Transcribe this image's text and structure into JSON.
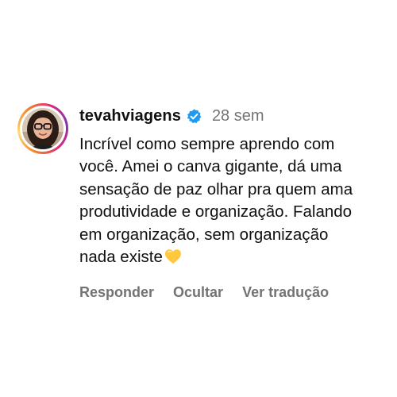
{
  "comment": {
    "username": "tevahviagens",
    "verified_icon": "verified-badge-icon",
    "verified_color": "#1d9bf0",
    "time": "28 sem",
    "text": "Incrível como sempre aprendo com\nvocê. Amei o canva gigante, dá uma\nsensação de paz olhar pra quem ama\nprodutividade e organização. Falando\nem organização, sem organização\nnada existe",
    "emoji_icon": "yellow-heart-icon",
    "emoji_color": "#ffc83d"
  },
  "actions": {
    "reply_label": "Responder",
    "hide_label": "Ocultar",
    "translate_label": "Ver tradução"
  },
  "colors": {
    "secondary_text": "#737373",
    "story_ring": [
      "#f58529",
      "#feda77",
      "#dd2a7b",
      "#8134af"
    ]
  }
}
